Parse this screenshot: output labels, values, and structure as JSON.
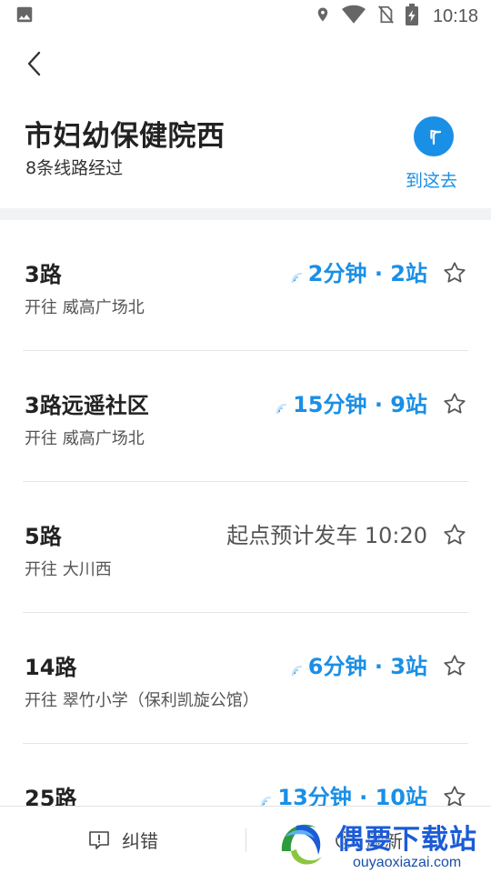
{
  "status_bar": {
    "time": "10:18",
    "icons": [
      "image-icon",
      "location-icon",
      "wifi-icon",
      "no-sim-icon",
      "battery-charging-icon"
    ]
  },
  "header": {
    "stop_name": "市妇幼保健院西",
    "route_count_text": "8条线路经过",
    "goto_label": "到这去",
    "accent_color": "#1a8fe6"
  },
  "routes": [
    {
      "name": "3路",
      "destination": "开往 威高广场北",
      "eta": "2分钟 · 2站",
      "realtime": true
    },
    {
      "name": "3路远遥社区",
      "destination": "开往 威高广场北",
      "eta": "15分钟 · 9站",
      "realtime": true
    },
    {
      "name": "5路",
      "destination": "开往 大川西",
      "eta": "起点预计发车 10:20",
      "realtime": false
    },
    {
      "name": "14路",
      "destination": "开往 翠竹小学（保利凯旋公馆）",
      "eta": "6分钟 · 3站",
      "realtime": true
    },
    {
      "name": "25路",
      "destination": "",
      "eta": "13分钟 · 10站",
      "realtime": true
    }
  ],
  "bottom_bar": {
    "report_label": "纠错",
    "refresh_label": "刷新"
  },
  "watermark": {
    "title": "偶要下载站",
    "url": "ouyaoxiazai.com"
  }
}
